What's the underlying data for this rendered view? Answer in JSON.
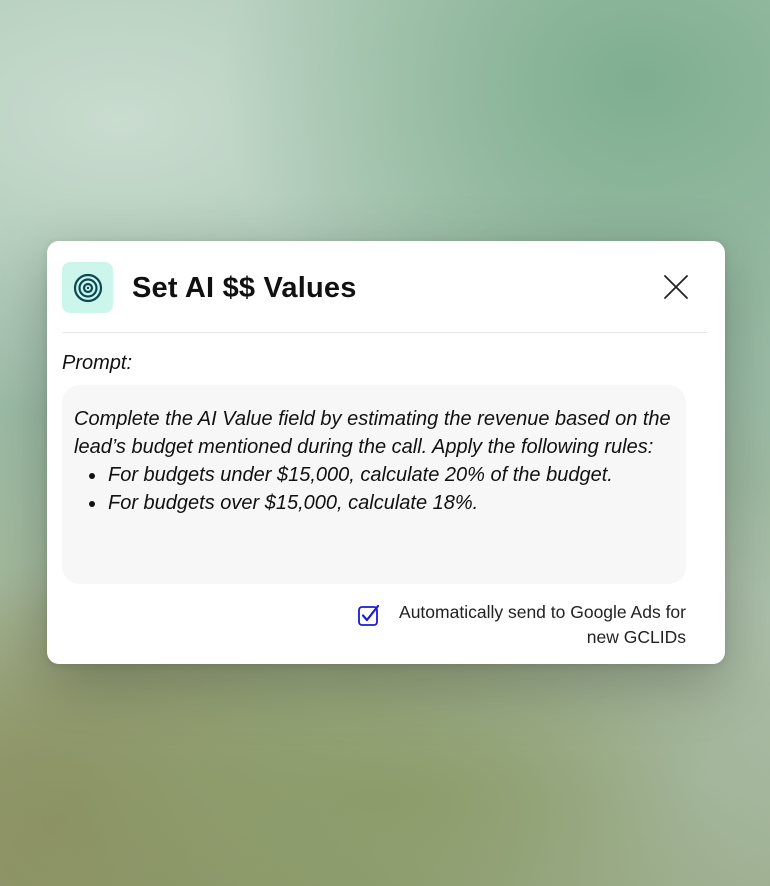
{
  "dialog": {
    "title": "Set AI $$ Values",
    "logo_icon": "target-icon",
    "close_icon": "close-icon"
  },
  "prompt": {
    "label": "Prompt:",
    "intro": "Complete the AI Value field by estimating the revenue based on the lead’s budget mentioned during the call. Apply the following rules:",
    "rules": [
      "For budgets under $15,000, calculate 20% of the budget.",
      "For budgets over $15,000, calculate 18%."
    ]
  },
  "auto_send": {
    "checked": true,
    "label": "Automatically send to Google Ads for new GCLIDs"
  },
  "colors": {
    "accent_icon_bg": "#ccf5ec",
    "accent_icon_stroke": "#0b4a52",
    "checkbox_blue": "#1a1ad6"
  }
}
